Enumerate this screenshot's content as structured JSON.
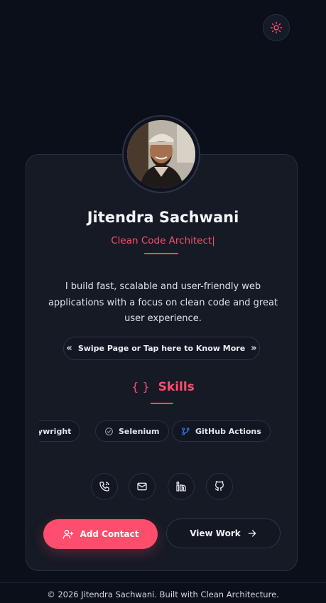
{
  "header": {
    "theme_toggle_icon": "sun-icon"
  },
  "profile": {
    "name": "Jitendra Sachwani",
    "role": "Clean Code Architect",
    "cursor": "|",
    "bio": "I build fast, scalable and user-friendly web applications with a focus on clean code and great user experience."
  },
  "swipe": {
    "prev_icon": "«",
    "label": "Swipe Page or Tap here to Know More",
    "next_icon": "»"
  },
  "skills": {
    "icon": "{ }",
    "title": "Skills",
    "items": [
      {
        "label": "Playwright",
        "icon": "playwright-icon"
      },
      {
        "label": "Selenium",
        "icon": "check-circle-icon"
      },
      {
        "label": "GitHub Actions",
        "icon": "git-branch-icon"
      }
    ]
  },
  "social": [
    {
      "name": "phone",
      "icon": "phone-icon"
    },
    {
      "name": "email",
      "icon": "mail-icon"
    },
    {
      "name": "linkedin",
      "icon": "linkedin-icon"
    },
    {
      "name": "github",
      "icon": "github-icon"
    }
  ],
  "actions": {
    "add_contact": "Add Contact",
    "view_work": "View Work"
  },
  "footer": {
    "text": "© 2026 Jitendra Sachwani. Built with Clean Architecture."
  },
  "colors": {
    "accent": "#ff4d6d",
    "background": "#0b0f19",
    "card": "#151a25"
  }
}
